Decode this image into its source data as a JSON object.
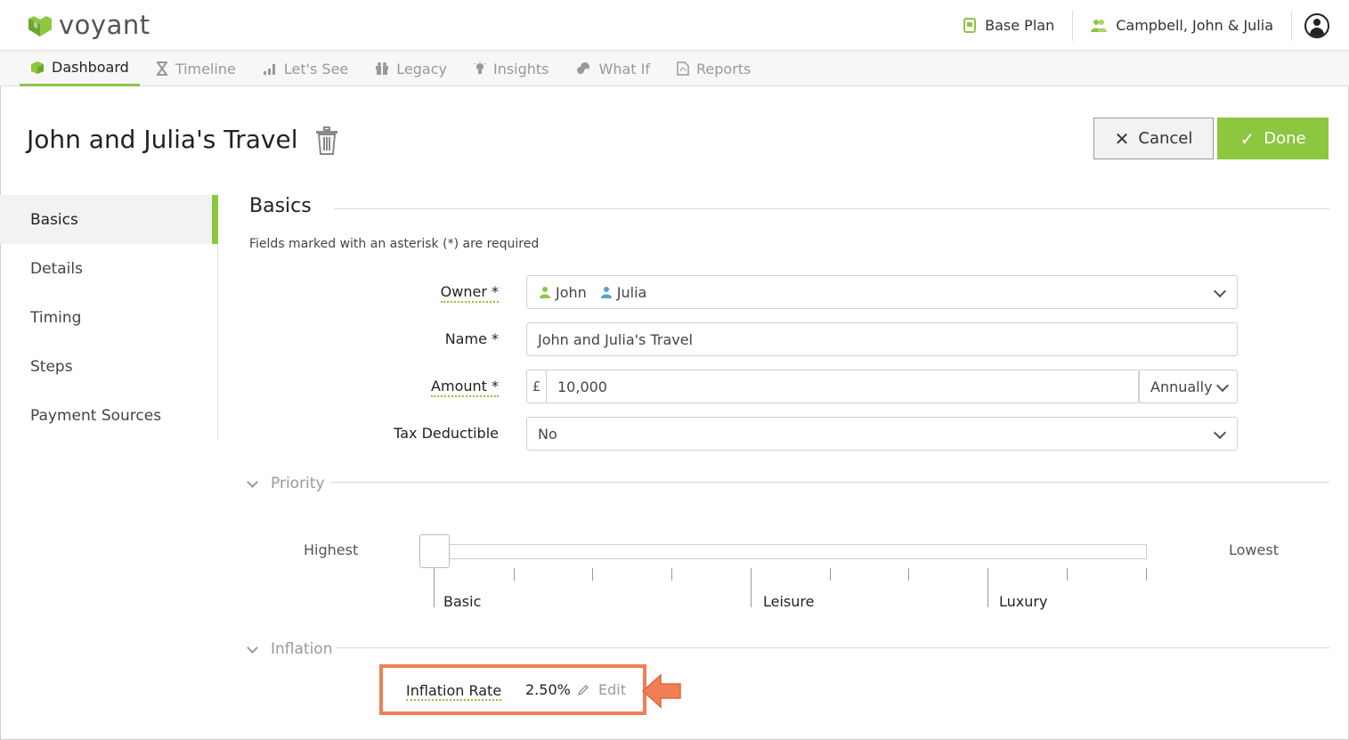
{
  "brand": {
    "name": "voyant"
  },
  "topbar": {
    "plan_label": "Base Plan",
    "client_label": "Campbell, John & Julia"
  },
  "nav": {
    "tabs": [
      {
        "label": "Dashboard",
        "icon": "cube-icon",
        "active": true
      },
      {
        "label": "Timeline",
        "icon": "hourglass-icon",
        "active": false
      },
      {
        "label": "Let's See",
        "icon": "bar-chart-icon",
        "active": false
      },
      {
        "label": "Legacy",
        "icon": "gift-icon",
        "active": false
      },
      {
        "label": "Insights",
        "icon": "lightbulb-icon",
        "active": false
      },
      {
        "label": "What If",
        "icon": "people-cloud-icon",
        "active": false
      },
      {
        "label": "Reports",
        "icon": "pdf-icon",
        "active": false
      }
    ]
  },
  "page": {
    "title": "John and Julia's Travel",
    "cancel_label": "Cancel",
    "done_label": "Done"
  },
  "sidebar": {
    "items": [
      {
        "label": "Basics",
        "active": true
      },
      {
        "label": "Details",
        "active": false
      },
      {
        "label": "Timing",
        "active": false
      },
      {
        "label": "Steps",
        "active": false
      },
      {
        "label": "Payment Sources",
        "active": false
      }
    ]
  },
  "basics": {
    "title": "Basics",
    "required_note": "Fields marked with an asterisk (*) are required",
    "owner_label": "Owner *",
    "owner_values": [
      "John",
      "Julia"
    ],
    "name_label": "Name *",
    "name_value": "John and Julia's Travel",
    "amount_label": "Amount *",
    "amount_currency": "£",
    "amount_value": "10,000",
    "amount_frequency": "Annually",
    "tax_label": "Tax Deductible",
    "tax_value": "No"
  },
  "priority": {
    "title": "Priority",
    "left_label": "Highest",
    "right_label": "Lowest",
    "categories": [
      "Basic",
      "Leisure",
      "Luxury"
    ],
    "level": 0
  },
  "inflation": {
    "title": "Inflation",
    "rate_label": "Inflation Rate",
    "rate_value": "2.50%",
    "edit_label": "Edit"
  },
  "colors": {
    "accent": "#8dc63f",
    "highlight": "#f07f55",
    "julia": "#5aa0c8"
  }
}
